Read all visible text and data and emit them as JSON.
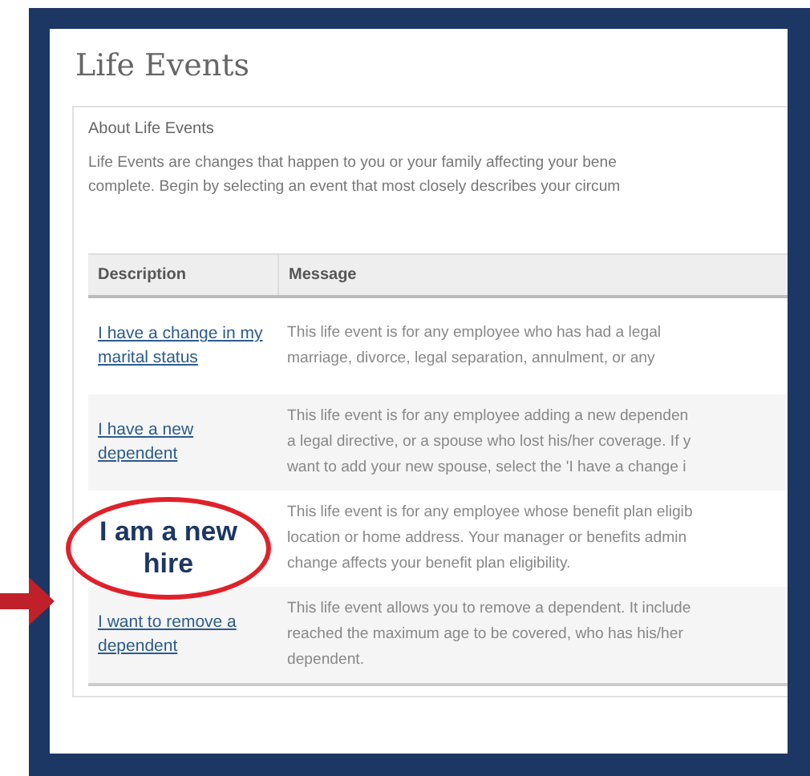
{
  "page": {
    "title": "Life Events"
  },
  "about": {
    "heading": "About Life Events",
    "lines": [
      "Life Events are changes that happen to you or your family affecting your bene",
      "complete. Begin by selecting an event that most closely describes your circum"
    ]
  },
  "table": {
    "columns": [
      "Description",
      "Message"
    ],
    "rows": [
      {
        "description": "I have a change in my marital status",
        "message": [
          "This life event is for any employee who has had a legal",
          "marriage, divorce, legal separation, annulment, or any"
        ]
      },
      {
        "description": "I have a new dependent",
        "message": [
          "This life event is for any employee adding a new dependen",
          "a legal directive, or a spouse who lost his/her coverage. If y",
          "want to add your new spouse, select the 'I have a change i"
        ]
      },
      {
        "message": [
          "This life event is for any employee whose benefit plan eligib",
          "location or home address. Your manager or benefits admin",
          "change affects your benefit plan eligibility."
        ]
      },
      {
        "description": "I want to remove a dependent",
        "message": [
          "This life event allows you to remove a dependent. It include",
          "reached the maximum age to be covered, who has his/her",
          "dependent."
        ]
      }
    ]
  },
  "callout": {
    "text": "I am a new hire"
  }
}
